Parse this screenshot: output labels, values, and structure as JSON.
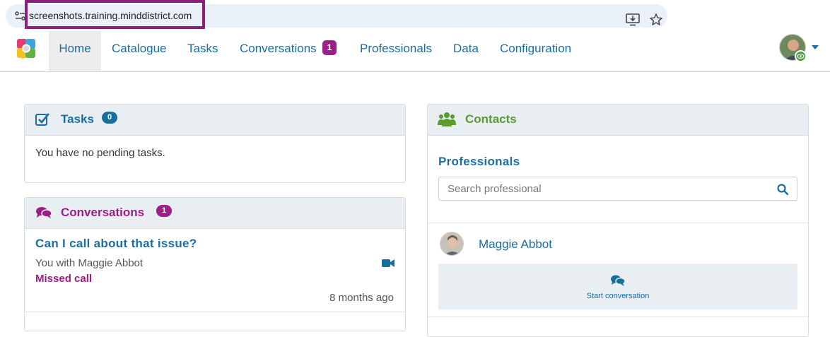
{
  "browser": {
    "url": "screenshots.training.minddistrict.com"
  },
  "nav": {
    "items": [
      {
        "label": "Home",
        "active": true
      },
      {
        "label": "Catalogue"
      },
      {
        "label": "Tasks"
      },
      {
        "label": "Conversations",
        "badge": "1"
      },
      {
        "label": "Professionals"
      },
      {
        "label": "Data"
      },
      {
        "label": "Configuration"
      }
    ]
  },
  "tasks": {
    "title": "Tasks",
    "count": "0",
    "empty_message": "You have no pending tasks."
  },
  "conversations": {
    "title": "Conversations",
    "count": "1",
    "items": [
      {
        "subject": "Can I call about that issue?",
        "participants": "You with Maggie Abbot",
        "status": "Missed call",
        "time": "8 months ago"
      }
    ]
  },
  "contacts": {
    "title": "Contacts",
    "professionals_heading": "Professionals",
    "search_placeholder": "Search professional",
    "people": [
      {
        "name": "Maggie Abbot",
        "action_label": "Start conversation"
      }
    ]
  },
  "colors": {
    "accent": "#1a6e9e",
    "conversations": "#9c1e86",
    "contacts": "#5a9a2f",
    "panel_header": "#e8eef2"
  },
  "icons": [
    "site-info-icon",
    "install-icon",
    "star-icon",
    "logo",
    "caret-icon",
    "check-icon",
    "chat-icon",
    "video-icon",
    "group-icon",
    "search-icon"
  ]
}
